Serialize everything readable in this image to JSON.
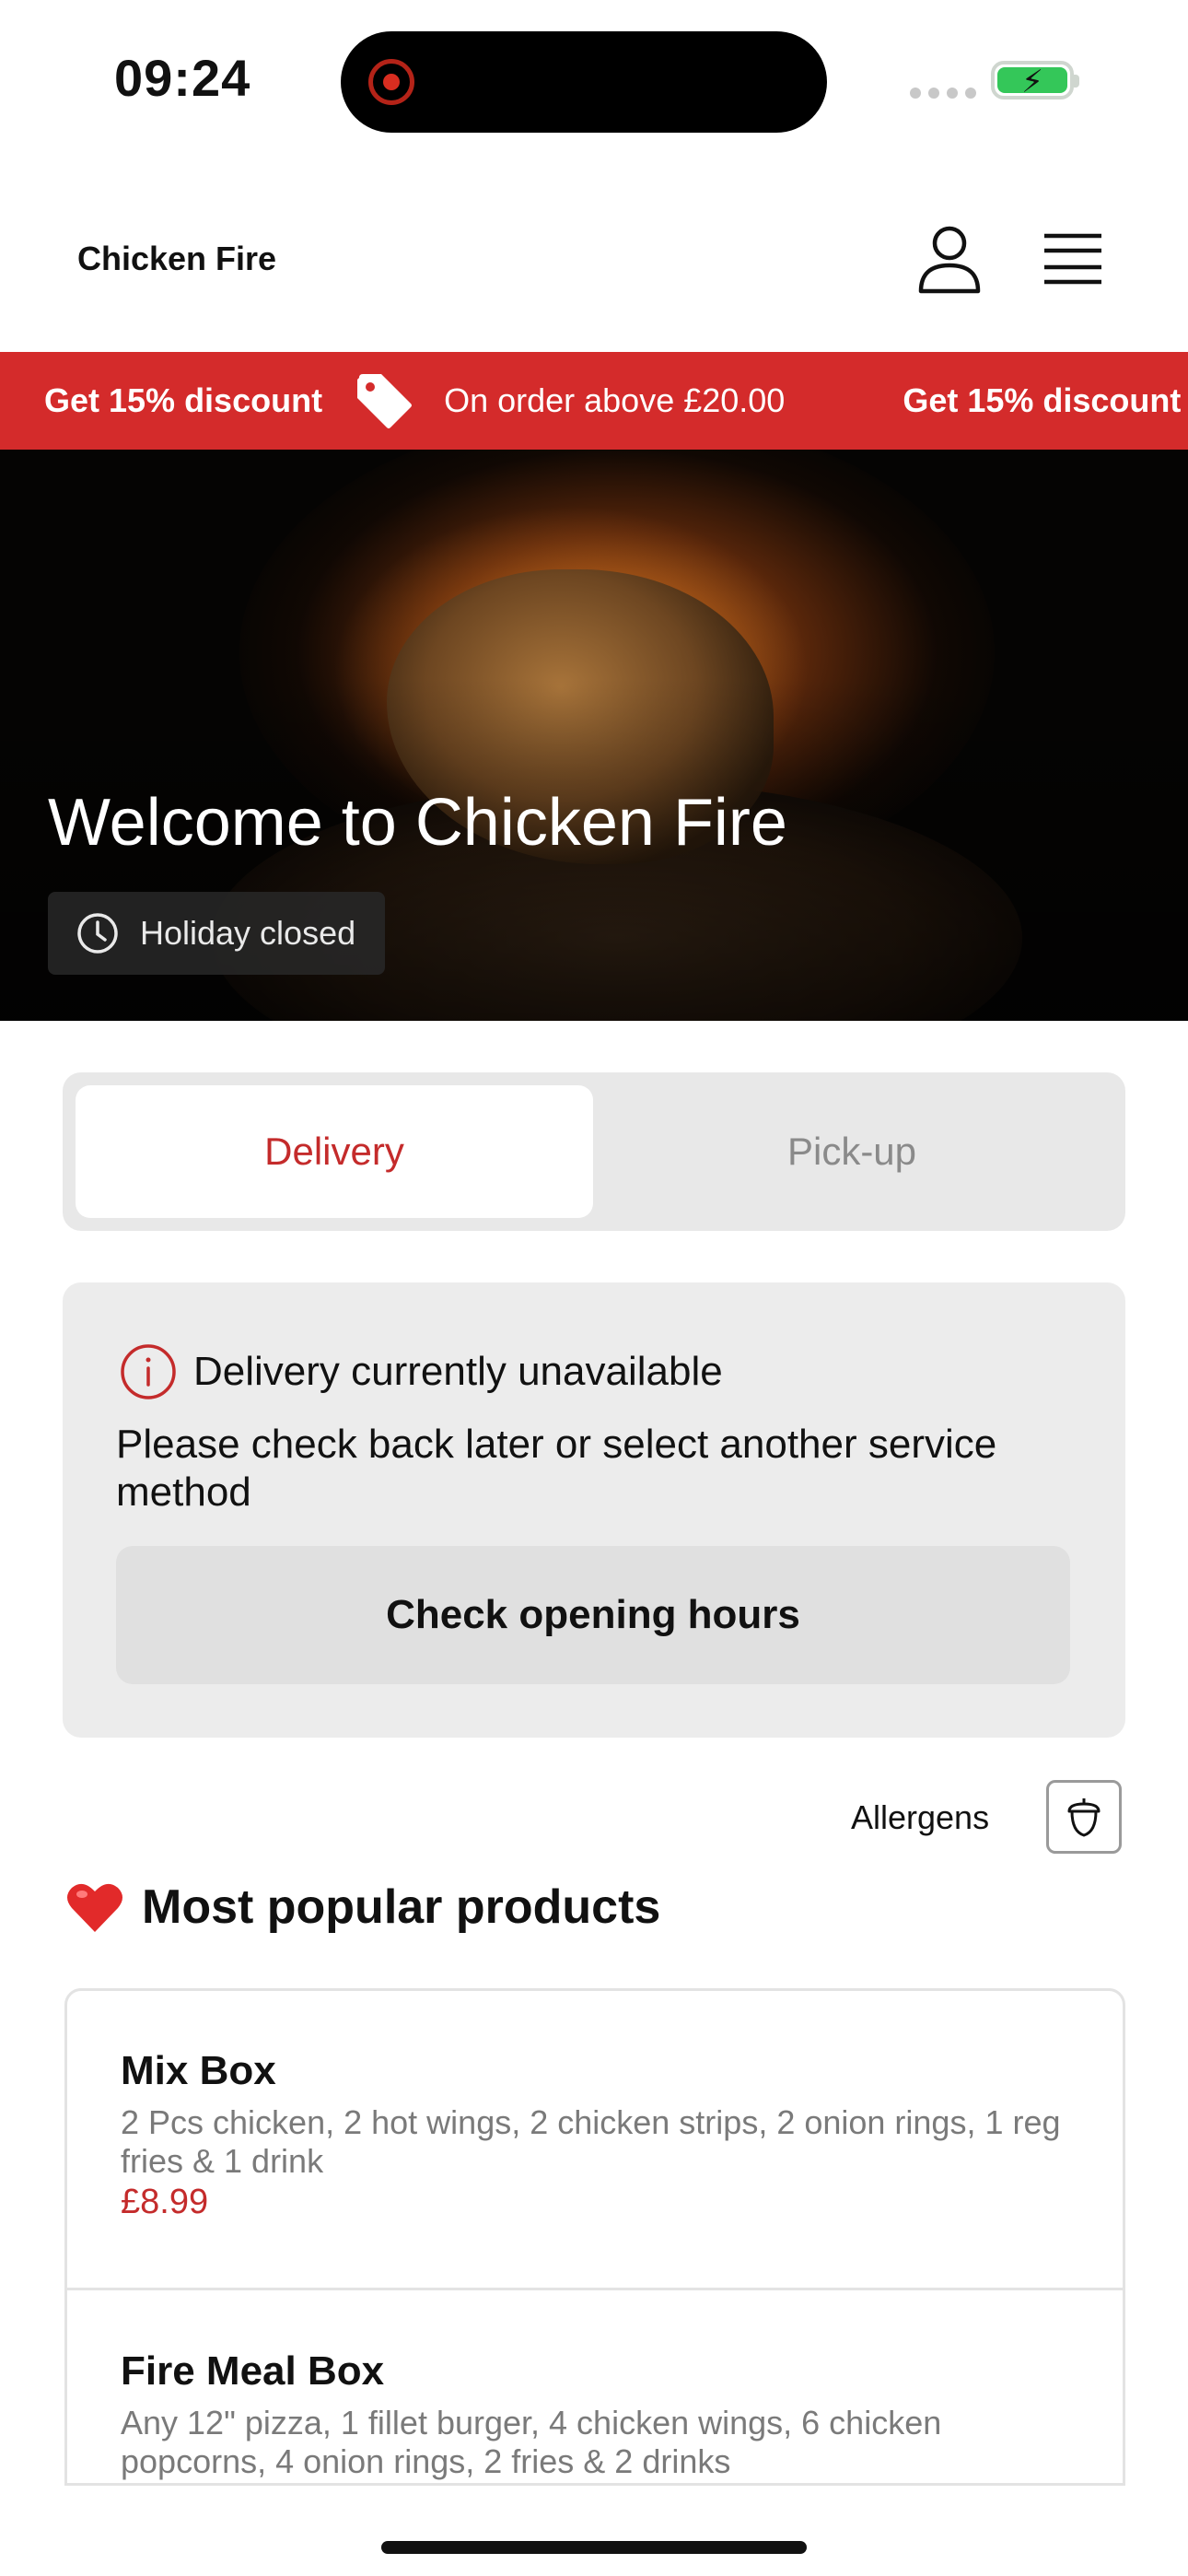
{
  "status_bar": {
    "time": "09:24"
  },
  "header": {
    "brand": "Chicken Fire"
  },
  "promo": {
    "discount_label": "Get 15% discount",
    "condition_label": "On order above £20.00",
    "repeat_label": "Get 15% discount"
  },
  "hero": {
    "title": "Welcome to Chicken Fire",
    "status": "Holiday closed"
  },
  "service_toggle": {
    "options": [
      {
        "label": "Delivery",
        "active": true
      },
      {
        "label": "Pick-up",
        "active": false
      }
    ]
  },
  "notice": {
    "title": "Delivery currently unavailable",
    "message": "Please check back later or select another service method",
    "button_label": "Check opening hours"
  },
  "allergens": {
    "label": "Allergens"
  },
  "popular": {
    "title": "Most popular products",
    "products": [
      {
        "name": "Mix Box",
        "description": "2 Pcs chicken, 2 hot wings, 2 chicken strips, 2 onion rings, 1 reg fries & 1 drink",
        "price": "£8.99"
      },
      {
        "name": "Fire Meal Box",
        "description": "Any 12\" pizza, 1 fillet burger, 4 chicken wings, 6 chicken popcorns, 4 onion rings, 2 fries & 2 drinks"
      }
    ]
  },
  "colors": {
    "accent": "#d42b2b",
    "price": "#c42b2b",
    "battery": "#34c759"
  }
}
